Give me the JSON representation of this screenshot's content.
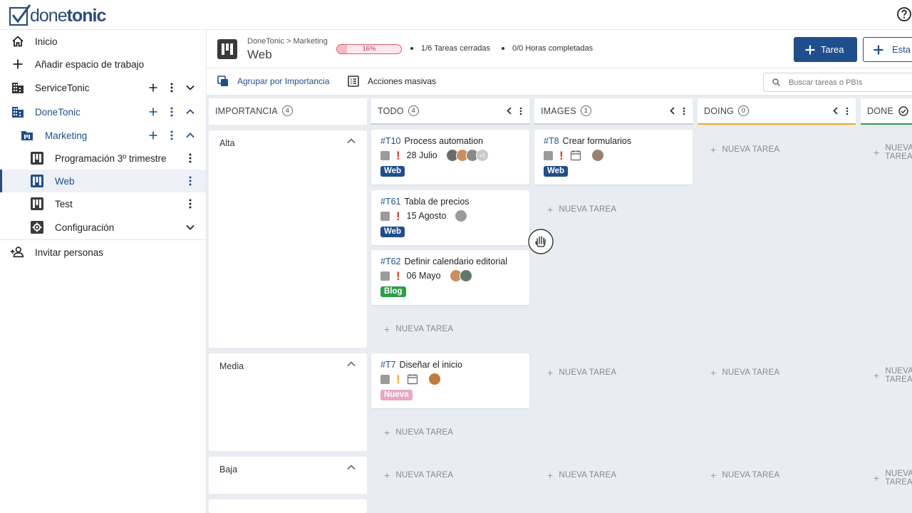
{
  "app": {
    "logo_part1": "done",
    "logo_part2": "tonic"
  },
  "colors": {
    "brand": "#1f4e8c",
    "tag_web": "#1f4e8c",
    "tag_blog": "#2e9e4a",
    "tag_nueva": "#e8a7c2",
    "priority_high": "#e03b20",
    "priority_medium": "#f2a91b",
    "done_line": "#2e9e4a",
    "doing_line": "#f2a91b"
  },
  "sidebar": {
    "items": [
      {
        "label": "Inicio",
        "icon": "home-icon"
      },
      {
        "label": "Añadir espacio de trabajo",
        "icon": "plus-icon"
      },
      {
        "label": "ServiceTonic",
        "icon": "building-icon"
      },
      {
        "label": "DoneTonic",
        "icon": "building-icon"
      },
      {
        "label": "Marketing",
        "icon": "folder-icon"
      },
      {
        "label": "Programación 3º trimestre",
        "icon": "board-icon"
      },
      {
        "label": "Web",
        "icon": "board-icon"
      },
      {
        "label": "Test",
        "icon": "board-icon"
      },
      {
        "label": "Configuración",
        "icon": "settings-icon"
      },
      {
        "label": "Invitar personas",
        "icon": "add-person-icon"
      }
    ]
  },
  "header": {
    "breadcrumb": "DoneTonic > Marketing",
    "title": "Web",
    "progress_label": "16%",
    "progress_value": 16,
    "closed_tasks": "1/6 Tareas cerradas",
    "hours": "0/0 Horas completadas",
    "task_button": "Tarea",
    "status_button": "Esta"
  },
  "toolbar": {
    "group_by": "Agrupar por Importancia",
    "bulk_actions": "Acciones masivas",
    "search_placeholder": "Buscar tareas o PBIs"
  },
  "board": {
    "group_header": {
      "name": "IMPORTANCIA",
      "count": "4"
    },
    "columns": [
      {
        "name": "TODO",
        "count": "4"
      },
      {
        "name": "IMAGES",
        "count": "1"
      },
      {
        "name": "DOING",
        "count": "0"
      },
      {
        "name": "DONE"
      }
    ],
    "groups": [
      {
        "label": "Alta"
      },
      {
        "label": "Media"
      },
      {
        "label": "Baja"
      }
    ],
    "new_task_label": "NUEVA TAREA",
    "cards": [
      {
        "id": "#T10",
        "title": "Process automation",
        "date": "28 Julio",
        "tag": "Web",
        "more": "+1"
      },
      {
        "id": "#T61",
        "title": "Tabla de precios",
        "date": "15 Agosto",
        "tag": "Web"
      },
      {
        "id": "#T62",
        "title": "Definir calendario editorial",
        "date": "06 Mayo",
        "tag": "Blog"
      },
      {
        "id": "#T8",
        "title": "Crear formularios",
        "tag": "Web"
      },
      {
        "id": "#T7",
        "title": "Diseñar el inicio",
        "tag": "Nueva"
      }
    ]
  }
}
